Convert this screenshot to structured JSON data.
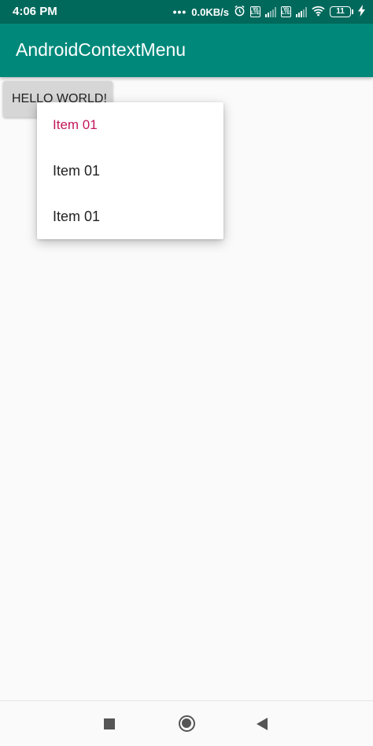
{
  "status_bar": {
    "time": "4:06 PM",
    "network_speed": "0.0KB/s",
    "sim1_badge": "Vo LTE",
    "sim2_badge": "Vo LTE",
    "battery_level": "11"
  },
  "app_bar": {
    "title": "AndroidContextMenu"
  },
  "main": {
    "button_label": "HELLO WORLD!"
  },
  "context_menu": {
    "items": [
      {
        "label": "Item 01"
      },
      {
        "label": "Item 01"
      },
      {
        "label": "Item 01"
      }
    ]
  },
  "colors": {
    "primary": "#00897b",
    "primary_dark": "#00695c",
    "accent": "#c2185b"
  }
}
